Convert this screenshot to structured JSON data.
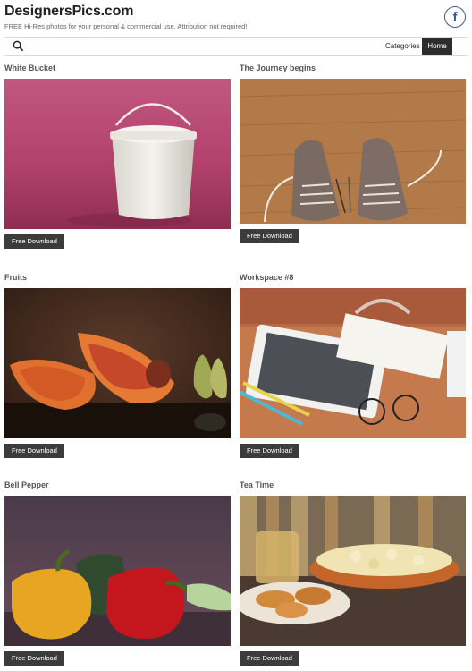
{
  "site": {
    "title": "DesignersPics.com",
    "tagline": "FREE Hi-Res photos for your personal & commercial use. Attribution not required!"
  },
  "social": {
    "icon": "facebook-icon",
    "glyph": "f",
    "color": "#3b5998"
  },
  "nav": {
    "search_icon": "search-icon",
    "items": [
      {
        "label": "Categories",
        "active": false
      },
      {
        "label": "Home",
        "active": true
      }
    ]
  },
  "posts": [
    {
      "title": "White Bucket",
      "image": "white bucket on pink backdrop",
      "button": "Free Download"
    },
    {
      "title": "The Journey begins",
      "image": "shoes on wooden floor with pencils",
      "button": "Free Download"
    },
    {
      "title": "Fruits",
      "image": "papaya halves and pears on dark table",
      "button": "Free Download"
    },
    {
      "title": "Workspace #8",
      "image": "tablet, notebook, pencils and glasses on desk",
      "button": "Free Download"
    },
    {
      "title": "Bell Pepper",
      "image": "yellow and red bell peppers with vegetables",
      "button": "Free Download"
    },
    {
      "title": "Tea Time",
      "image": "popcorn bowl, cookies and tea on table",
      "button": "Free Download"
    }
  ]
}
